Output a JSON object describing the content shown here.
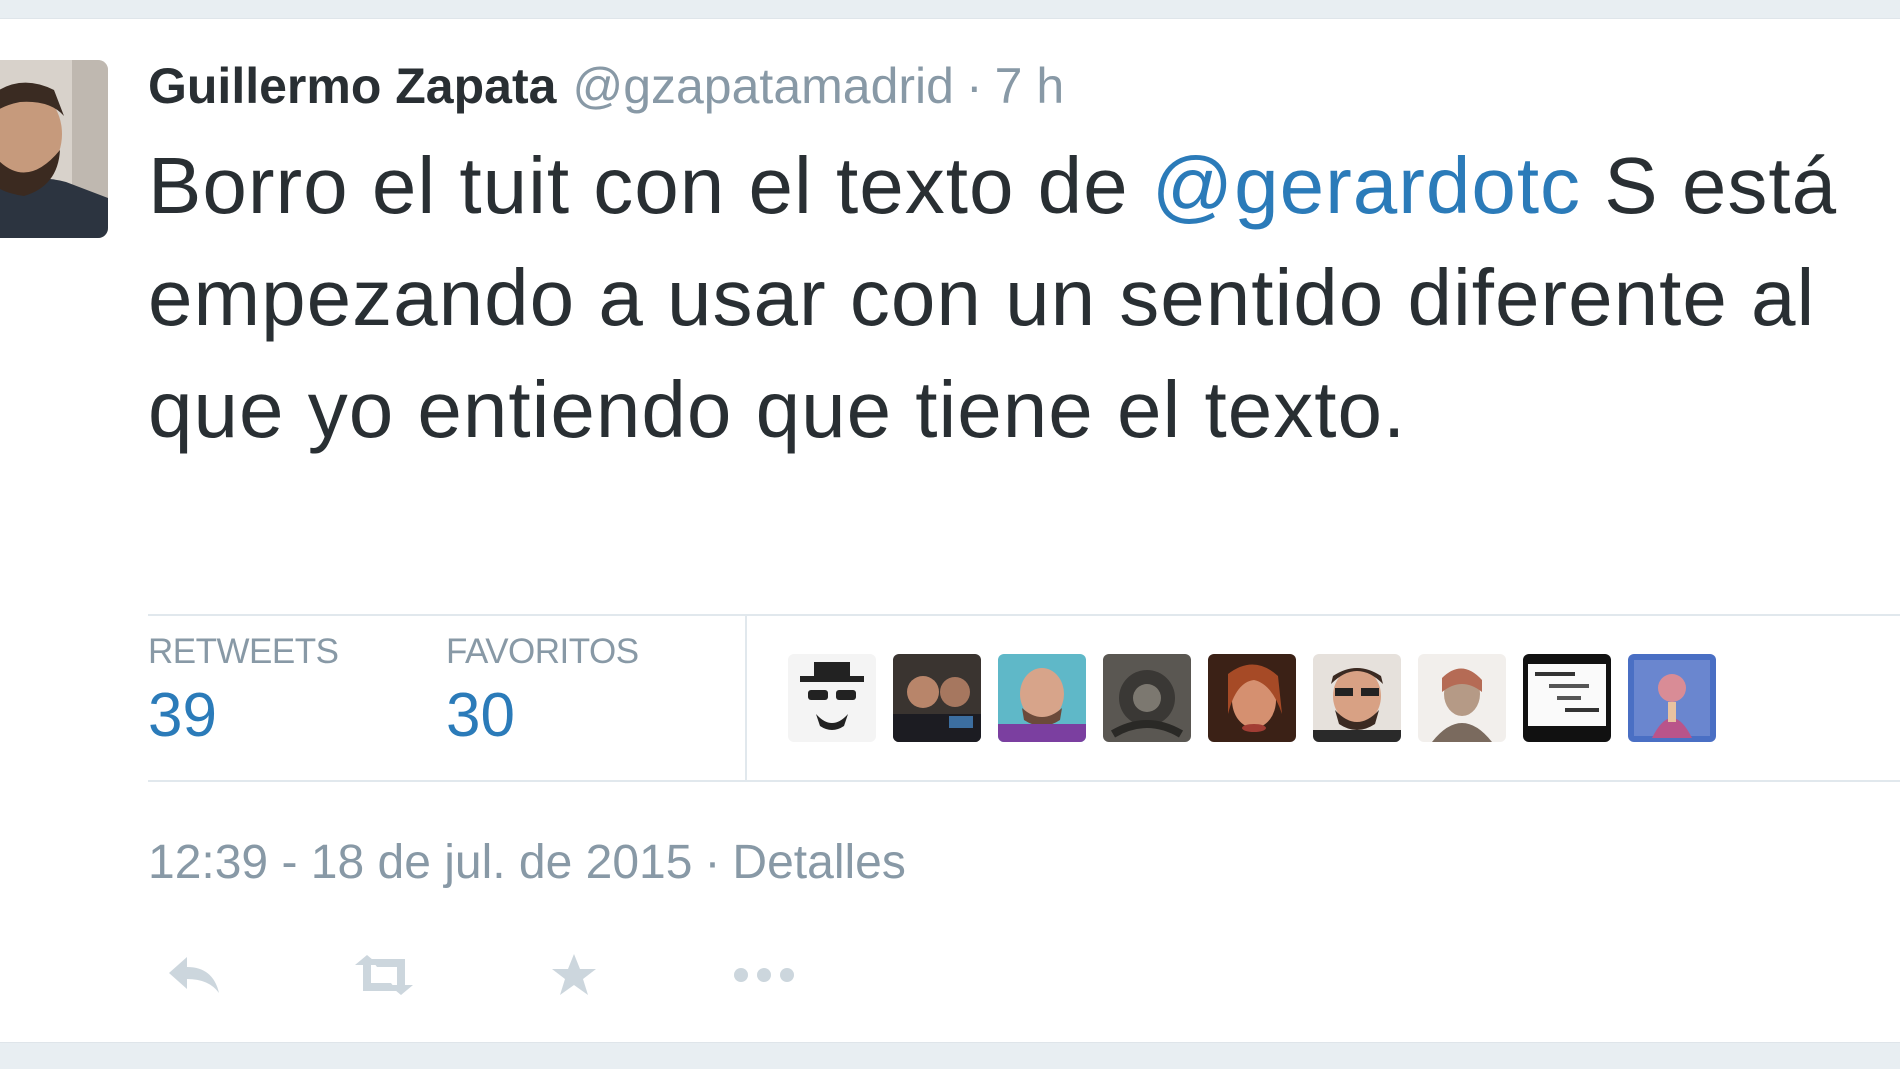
{
  "tweet": {
    "author_name": "Guillermo Zapata",
    "author_handle": "@gzapatamadrid",
    "separator": "·",
    "relative_time": "7 h",
    "text_before": "Borro el tuit con el texto de ",
    "mention": "@gerardotc",
    "text_after": " S está empezando a usar con un sentido diferente al que yo entiendo que tiene el texto."
  },
  "stats": {
    "retweets_label": "RETWEETS",
    "retweets_count": "39",
    "favorites_label": "FAVORITOS",
    "favorites_count": "30"
  },
  "footer": {
    "datetime": "12:39 - 18 de jul. de 2015",
    "separator": "·",
    "details_link": "Detalles"
  },
  "actions": [
    {
      "icon": "reply-icon"
    },
    {
      "icon": "retweet-icon"
    },
    {
      "icon": "favorite-star-icon"
    },
    {
      "icon": "more-options-icon"
    }
  ],
  "colors": {
    "link": "#2b7bb9",
    "text": "#292f33",
    "muted": "#8899a6",
    "icon": "#ccd6dd",
    "divider": "#e1e8ed",
    "page_background": "#e8eef2"
  }
}
